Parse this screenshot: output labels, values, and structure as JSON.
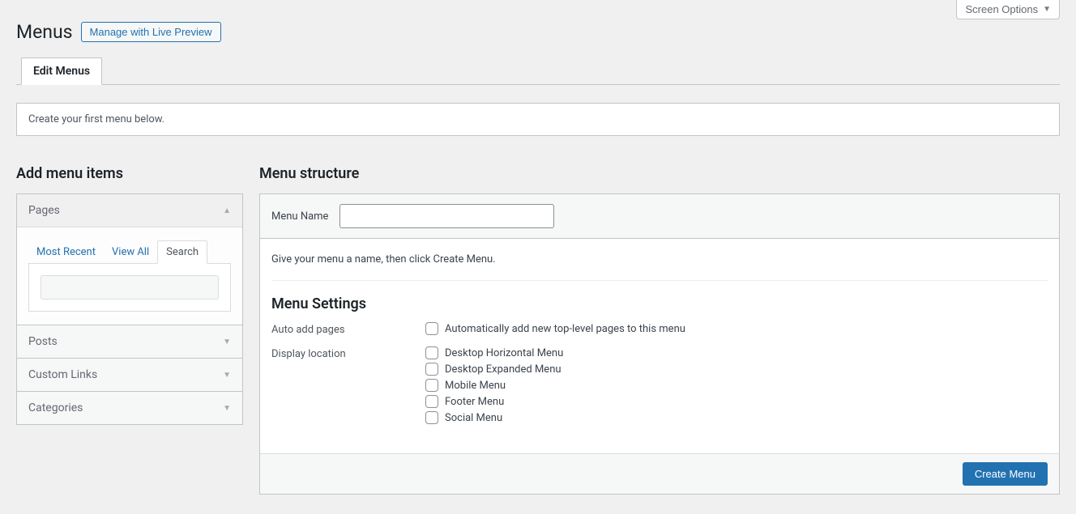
{
  "screenOptions": {
    "label": "Screen Options"
  },
  "header": {
    "title": "Menus",
    "livePreview": "Manage with Live Preview"
  },
  "tabs": [
    {
      "label": "Edit Menus",
      "active": true
    }
  ],
  "notice": "Create your first menu below.",
  "left": {
    "title": "Add menu items",
    "accordion": [
      {
        "label": "Pages",
        "open": true,
        "innerTabs": [
          {
            "label": "Most Recent",
            "active": false
          },
          {
            "label": "View All",
            "active": false
          },
          {
            "label": "Search",
            "active": true
          }
        ],
        "searchValue": ""
      },
      {
        "label": "Posts",
        "open": false
      },
      {
        "label": "Custom Links",
        "open": false
      },
      {
        "label": "Categories",
        "open": false
      }
    ]
  },
  "right": {
    "title": "Menu structure",
    "menuNameLabel": "Menu Name",
    "menuNameValue": "",
    "instruction": "Give your menu a name, then click Create Menu.",
    "settingsTitle": "Menu Settings",
    "autoAdd": {
      "label": "Auto add pages",
      "option": "Automatically add new top-level pages to this menu"
    },
    "displayLocation": {
      "label": "Display location",
      "options": [
        "Desktop Horizontal Menu",
        "Desktop Expanded Menu",
        "Mobile Menu",
        "Footer Menu",
        "Social Menu"
      ]
    },
    "createButton": "Create Menu"
  }
}
